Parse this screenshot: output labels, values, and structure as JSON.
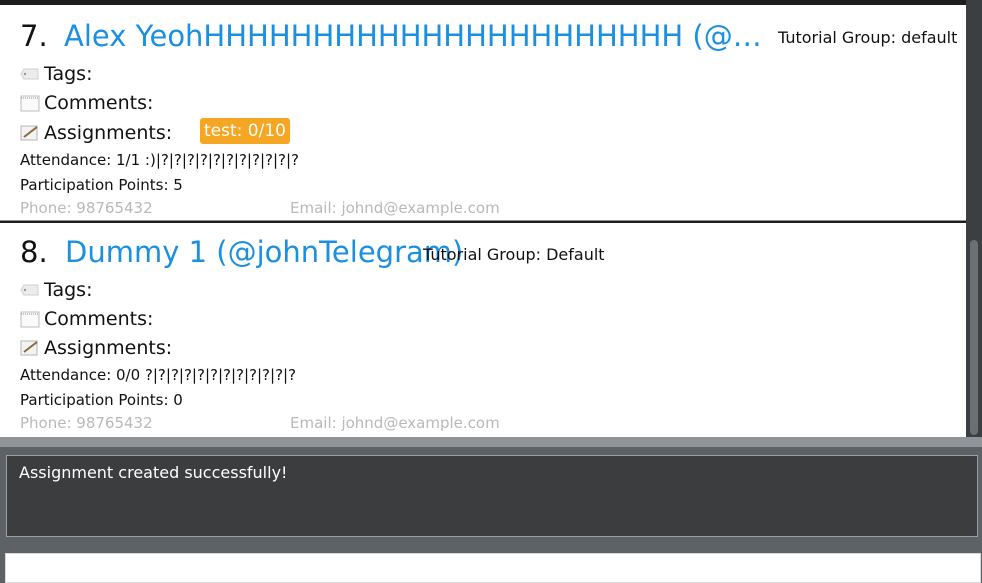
{
  "persons": [
    {
      "index": "7.",
      "name": "Alex YeohHHHHHHHHHHHHHHHHHHHHHH (@johnTe...",
      "tutorial_group": "Tutorial Group: default",
      "tags_label": "Tags:",
      "comments_label": "Comments:",
      "assignments_label": "Assignments:",
      "assignment_badge": "test: 0/10",
      "attendance": "Attendance: 1/1  :)|?|?|?|?|?|?|?|?|?|?|?",
      "participation": "Participation Points: 5",
      "phone": "Phone: 98765432",
      "email": "Email: johnd@example.com"
    },
    {
      "index": "8.",
      "name": "Dummy 1 (@johnTelegram)",
      "tutorial_group": "Tutorial Group: Default",
      "tags_label": "Tags:",
      "comments_label": "Comments:",
      "assignments_label": "Assignments:",
      "attendance": "Attendance: 0/0  ?|?|?|?|?|?|?|?|?|?|?|?",
      "participation": "Participation Points: 0",
      "phone": "Phone: 98765432",
      "email": "Email: johnd@example.com"
    }
  ],
  "result_display": {
    "message": "Assignment created successfully!"
  },
  "command_box": {
    "value": ""
  },
  "icons": {
    "tag": "tag-icon",
    "comment": "notepad-icon",
    "assignment": "memo-icon"
  }
}
